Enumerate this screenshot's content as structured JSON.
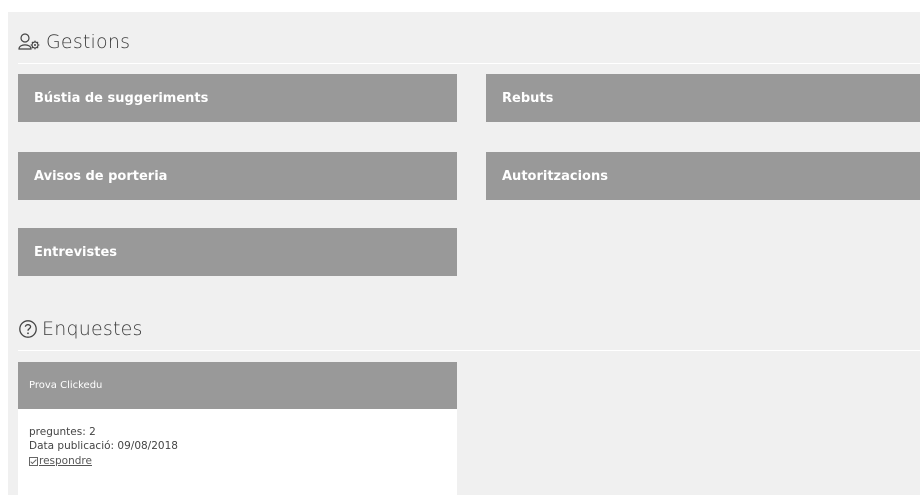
{
  "gestions": {
    "title": "Gestions",
    "icon": "users-gear-icon",
    "tiles": [
      {
        "label": "Bústia de suggeriments"
      },
      {
        "label": "Rebuts"
      },
      {
        "label": "Avisos de porteria"
      },
      {
        "label": "Autoritzacions"
      },
      {
        "label": "Entrevistes"
      }
    ]
  },
  "enquestes": {
    "title": "Enquestes",
    "icon": "question-circle-icon",
    "surveys": [
      {
        "name": "Prova Clickedu",
        "questions": "preguntes: 2",
        "published": "Data publicació: 09/08/2018",
        "respond_label": "respondre"
      }
    ]
  },
  "colors": {
    "panel_bg": "#f0f0f0",
    "tile_bg": "#999999",
    "tile_text": "#ffffff"
  }
}
